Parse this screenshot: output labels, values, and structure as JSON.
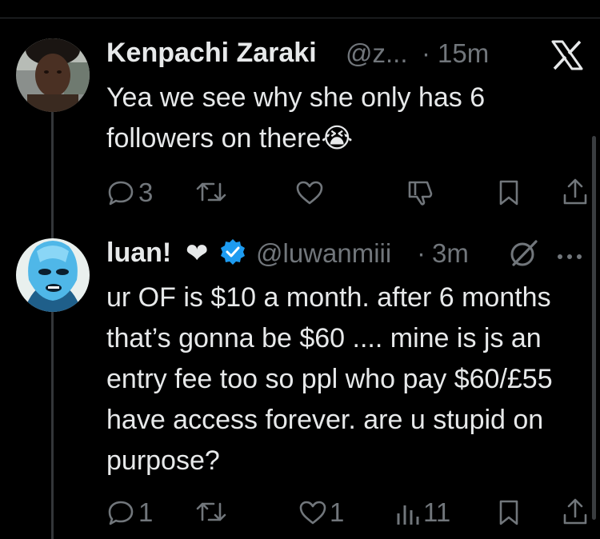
{
  "tweets": [
    {
      "name": "Kenpachi Zaraki",
      "handle": "@z...",
      "sep": "·",
      "time": "15m",
      "text": "Yea we see why she only has 6 followers on there",
      "emoji": "😭",
      "actions": {
        "reply_count": "3",
        "retweet_count": "",
        "like_count": ""
      },
      "corner_icon": "x-logo-icon"
    },
    {
      "name": "luan!",
      "heart_emoji": "❤",
      "handle": "@luwanmiii",
      "sep": "·",
      "time": "3m",
      "text": "ur OF is $10 a month. after 6 months that’s gonna be $60 .... mine is js an entry fee too so ppl who pay $60/£55 have access forever. are u stupid on purpose?",
      "actions": {
        "reply_count": "1",
        "retweet_count": "",
        "like_count": "1",
        "views_count": "11"
      },
      "corner_icons": [
        "grok-icon",
        "more-icon"
      ]
    }
  ],
  "colors": {
    "background": "#000000",
    "text": "#e7e9ea",
    "muted": "#71767b",
    "verified": "#1d9bf0"
  }
}
